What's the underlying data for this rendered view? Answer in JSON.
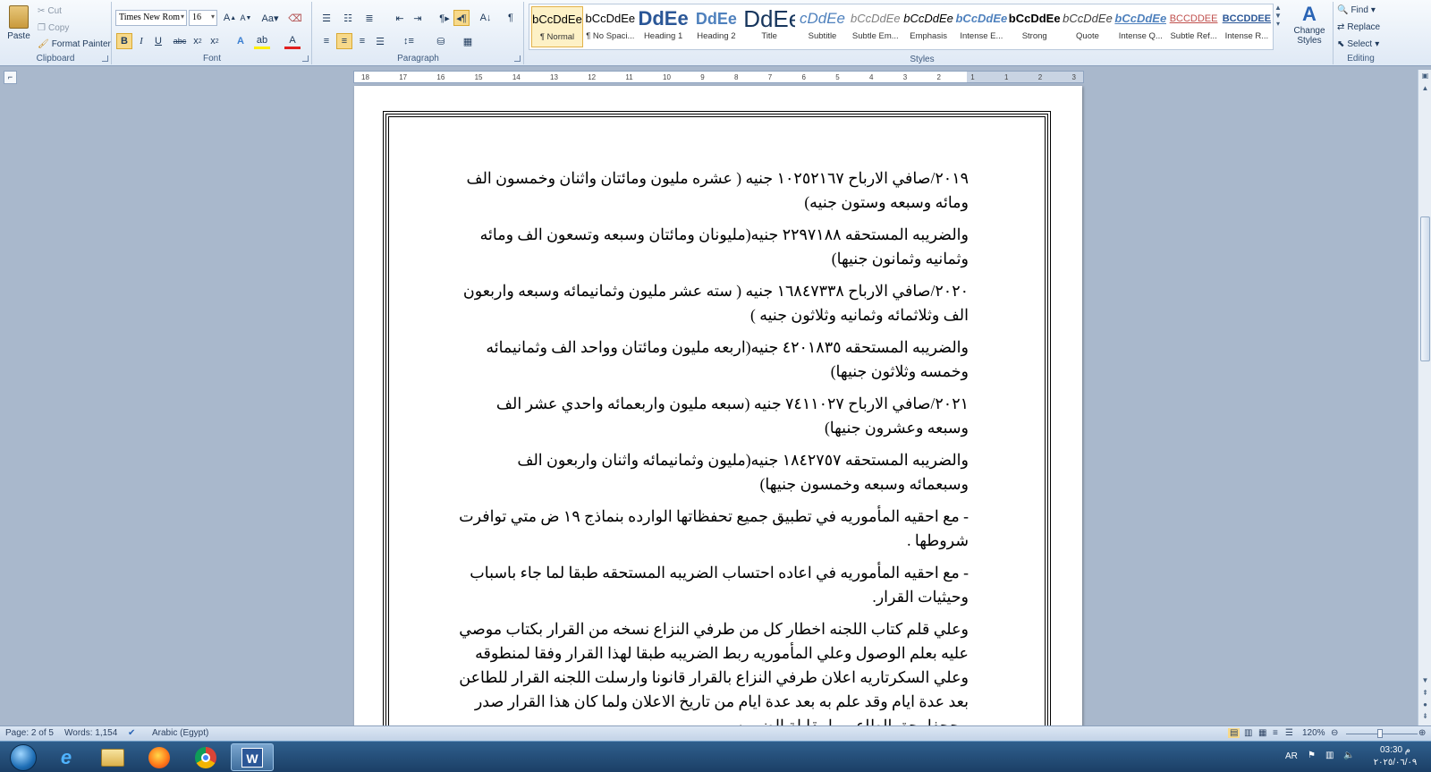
{
  "ribbon": {
    "clipboard": {
      "paste": "Paste",
      "cut": "Cut",
      "copy": "Copy",
      "format_painter": "Format Painter",
      "label": "Clipboard"
    },
    "font": {
      "font_name": "Times New Rom",
      "font_size": "16",
      "label": "Font"
    },
    "paragraph": {
      "label": "Paragraph"
    },
    "styles": {
      "label": "Styles",
      "items": [
        {
          "sample": "bCcDdEe",
          "label": "¶ Normal"
        },
        {
          "sample": "bCcDdEe",
          "label": "¶ No Spaci..."
        },
        {
          "sample": "DdEe",
          "label": "Heading 1"
        },
        {
          "sample": "DdEe",
          "label": "Heading 2"
        },
        {
          "sample": "DdEe",
          "label": "Title"
        },
        {
          "sample": "cDdEe",
          "label": "Subtitle"
        },
        {
          "sample": "bCcDdEe",
          "label": "Subtle Em..."
        },
        {
          "sample": "bCcDdEe",
          "label": "Emphasis"
        },
        {
          "sample": "bCcDdEe",
          "label": "Intense E..."
        },
        {
          "sample": "bCcDdEe",
          "label": "Strong"
        },
        {
          "sample": "bCcDdEe",
          "label": "Quote"
        },
        {
          "sample": "bCcDdEe",
          "label": "Intense Q..."
        },
        {
          "sample": "BCCDDEE",
          "label": "Subtle Ref..."
        },
        {
          "sample": "BCCDDEE",
          "label": "Intense R..."
        }
      ],
      "change_styles": "Change Styles"
    },
    "editing": {
      "find": "Find",
      "replace": "Replace",
      "select": "Select",
      "label": "Editing"
    }
  },
  "ruler": {
    "ticks": [
      "18",
      "17",
      "16",
      "15",
      "14",
      "13",
      "12",
      "11",
      "10",
      "9",
      "8",
      "7",
      "6",
      "5",
      "4",
      "3",
      "2",
      "1",
      "1",
      "2",
      "3"
    ]
  },
  "document": {
    "paragraphs": [
      "٢٠١٩/صافي الارباح ١٠٢٥٢١٦٧ جنيه ( عشره مليون ومائتان واثنان وخمسون الف ومائه وسبعه وستون جنيه)",
      "والضريبه المستحقه ٢٢٩٧١٨٨ جنيه(مليونان ومائتان وسبعه وتسعون الف ومائه وثمانيه وثمانون جنيها)",
      "٢٠٢٠/صافي الارباح ١٦٨٤٧٣٣٨ جنيه ( سته عشر مليون وثمانيمائه وسبعه واربعون الف وثلاثمائه وثمانيه وثلاثون جنيه )",
      "والضريبه المستحقه ٤٢٠١٨٣٥ جنيه(اربعه مليون ومائتان وواحد الف وثمانيمائه وخمسه وثلاثون جنيها)",
      "٢٠٢١/صافي الارباح ٧٤١١٠٢٧ جنيه (سبعه مليون واربعمائه واحدي عشر الف وسبعه وعشرون جنيها)",
      "والضريبه المستحقه ١٨٤٢٧٥٧ جنيه(مليون وثمانيمائه واثنان واربعون الف وسبعمائه وسبعه وخمسون جنيها)",
      "- مع احقيه المأموريه في تطبيق جميع تحفظاتها الوارده بنماذج ١٩ ض متي توافرت شروطها .",
      "- مع احقيه المأموريه في اعاده احتساب الضريبه المستحقه طبقا لما جاء باسباب وحيثيات القرار.",
      "وعلي قلم كتاب اللجنه اخطار كل من طرفي النزاع نسخه من القرار بكتاب موصي عليه بعلم الوصول وعلي المأموريه ربط الضريبه طبقا لهذا القرار وفقا لمنطوقه وعلي السكرتاريه اعلان طرفي النزاع بالقرار قانونا وارسلت اللجنه القرار للطاعن بعد عدة ايام وقد علم به بعد عدة ايام من تاريخ الاعلان ولما كان هذا القرار صدر مجحفا بحق الطاعن ولمقابلة الضريبه"
    ]
  },
  "status_bar": {
    "page": "Page: 2 of 5",
    "words": "Words: 1,154",
    "language": "Arabic (Egypt)",
    "zoom": "120%"
  },
  "taskbar": {
    "lang": "AR",
    "time": "03:30 م",
    "date": "٢٠٢٥/٠٦/٠٩"
  },
  "colors": {
    "ribbon_bg": "#dfe9f5",
    "doc_bg": "#a9b8cc",
    "taskbar": "#1b3f66",
    "selected_style": "#fdf1c6"
  }
}
